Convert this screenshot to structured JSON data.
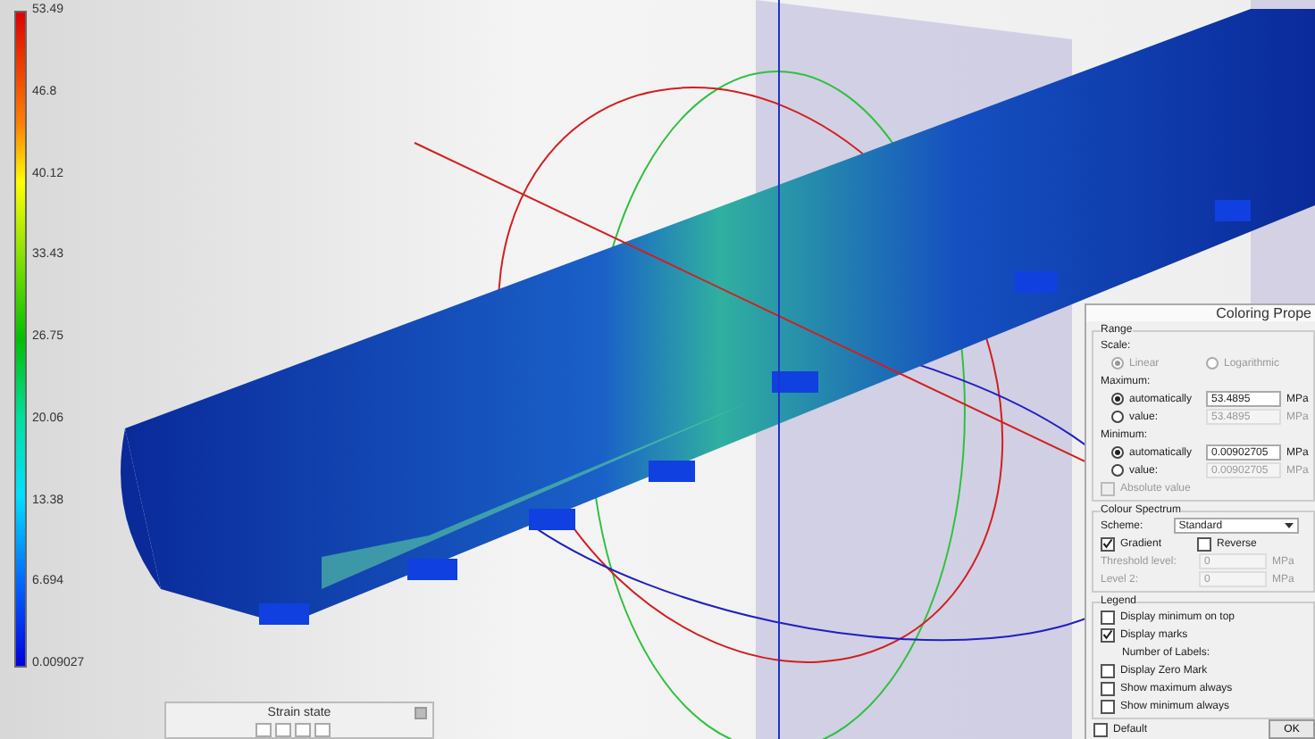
{
  "legend": {
    "labels": [
      "53.49",
      "46.8",
      "40.12",
      "33.43",
      "26.75",
      "20.06",
      "13.38",
      "6.694",
      "0.009027"
    ]
  },
  "dialog": {
    "title": "Coloring Prope",
    "range": {
      "heading": "Range",
      "scale_label": "Scale:",
      "scale_options": [
        {
          "label": "Linear",
          "selected": true,
          "disabled": true
        },
        {
          "label": "Logarithmic",
          "selected": false,
          "disabled": true
        }
      ],
      "limits": [
        {
          "label": "Maximum:",
          "options": [
            {
              "label": "automatically",
              "selected": true,
              "value": "53.4895",
              "unit": "MPa",
              "disabled": false
            },
            {
              "label": "value:",
              "selected": false,
              "value": "53.4895",
              "unit": "MPa",
              "disabled": true
            }
          ]
        },
        {
          "label": "Minimum:",
          "options": [
            {
              "label": "automatically",
              "selected": true,
              "value": "0.00902705",
              "unit": "MPa",
              "disabled": false
            },
            {
              "label": "value:",
              "selected": false,
              "value": "0.00902705",
              "unit": "MPa",
              "disabled": true
            }
          ]
        }
      ],
      "absolute": {
        "label": "Absolute value",
        "checked": false,
        "disabled": true
      }
    },
    "spectrum": {
      "heading": "Colour Spectrum",
      "scheme_label": "Scheme:",
      "scheme": "Standard",
      "gradient": {
        "label": "Gradient",
        "checked": true
      },
      "reverse": {
        "label": "Reverse",
        "checked": false
      },
      "levels": [
        {
          "label": "Threshold level:",
          "value": "0",
          "unit": "MPa",
          "disabled": true
        },
        {
          "label": "Level 2:",
          "value": "0",
          "unit": "MPa",
          "disabled": true
        }
      ]
    },
    "legend": {
      "heading": "Legend",
      "items": [
        {
          "kind": "checkbox",
          "label": "Display minimum on top",
          "checked": false
        },
        {
          "kind": "checkbox",
          "label": "Display marks",
          "checked": true
        },
        {
          "kind": "label",
          "label": "Number of Labels:"
        },
        {
          "kind": "checkbox",
          "label": "Display Zero Mark",
          "checked": false
        },
        {
          "kind": "checkbox",
          "label": "Show maximum always",
          "checked": false
        },
        {
          "kind": "checkbox",
          "label": "Show minimum always",
          "checked": false
        }
      ]
    },
    "default": {
      "label": "Default",
      "checked": false
    },
    "ok_button": "OK"
  },
  "strain_panel": {
    "title": "Strain state"
  }
}
